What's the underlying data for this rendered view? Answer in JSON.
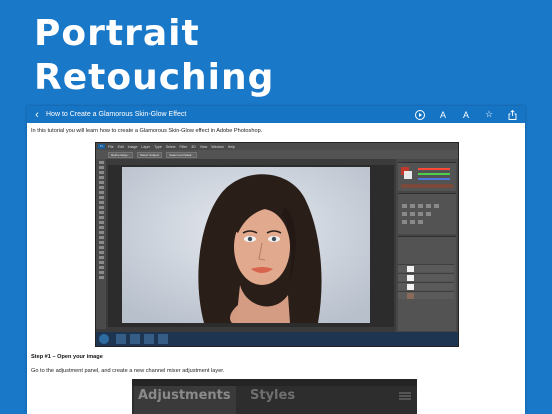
{
  "headline": {
    "line1": "Portrait",
    "line2": "Retouching"
  },
  "navbar": {
    "title": "How to Create a Glamorous Skin-Glow Effect",
    "back_icon": "chevron-left-icon",
    "actions": [
      {
        "name": "play-icon"
      },
      {
        "name": "font-decrease-icon",
        "glyph": "A"
      },
      {
        "name": "font-increase-icon",
        "glyph": "A"
      },
      {
        "name": "star-icon",
        "glyph": "☆"
      },
      {
        "name": "share-icon"
      }
    ]
  },
  "article": {
    "intro": "In this tutorial you will learn how to create a Glamorous Skin-Glow effect in Adobe Photoshop.",
    "step1_heading": "Step #1 – Open your image",
    "step1_text": "Go to the adjustment panel, and create a new channel mixer adjustment layer."
  },
  "photoshop": {
    "logo": "Ps",
    "menu": [
      "File",
      "Edit",
      "Image",
      "Layer",
      "Type",
      "Select",
      "Filter",
      "3D",
      "View",
      "Window",
      "Help"
    ],
    "options": [
      "Refine Edge...",
      "Select Subject",
      "Select and Mask..."
    ]
  },
  "adjustments_panel": {
    "tabs": [
      "Adjustments",
      "Styles"
    ]
  },
  "colors": {
    "brand_blue": "#1a78c9",
    "navbar_blue": "#1674c4"
  }
}
